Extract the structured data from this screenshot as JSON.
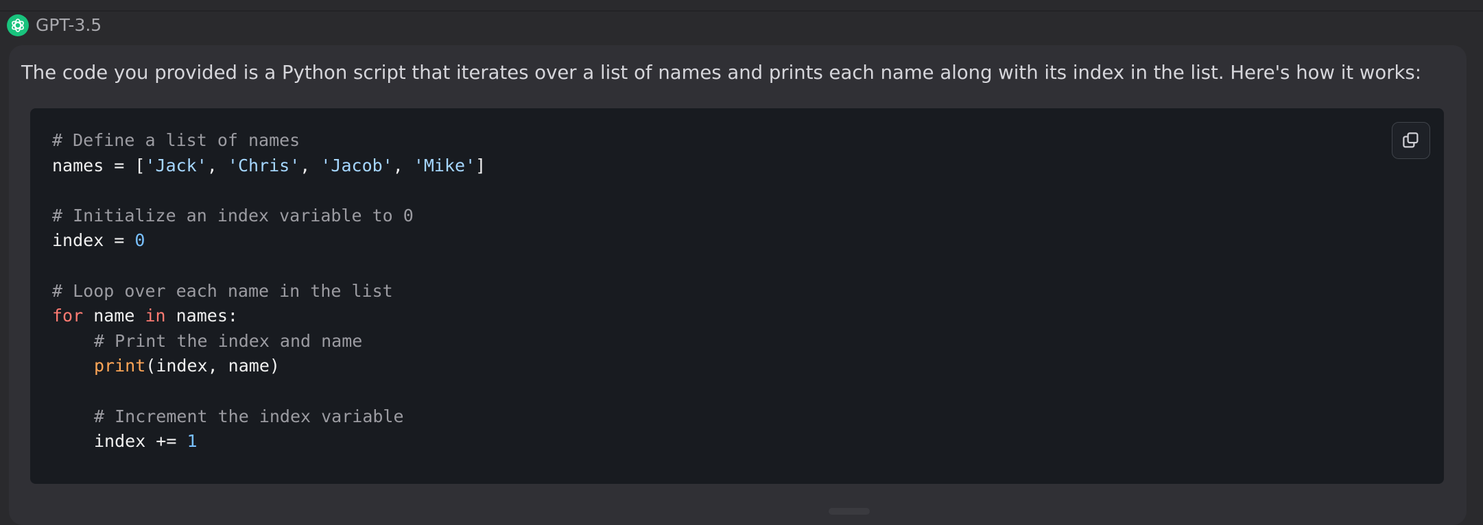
{
  "model": {
    "name": "GPT-3.5",
    "logo_icon": "openai-logo-icon",
    "logo_color": "#19c37d"
  },
  "message": {
    "intro": "The code you provided is a Python script that iterates over a list of names and prints each name along with its index in the list. Here's how it works:"
  },
  "code_block": {
    "language": "python",
    "copy_icon": "copy-icon",
    "lines": [
      {
        "indent": 0,
        "tokens": [
          {
            "t": "comment",
            "v": "# Define a list of names"
          }
        ]
      },
      {
        "indent": 0,
        "tokens": [
          {
            "t": "plain",
            "v": "names = ["
          },
          {
            "t": "string",
            "v": "'Jack'"
          },
          {
            "t": "plain",
            "v": ", "
          },
          {
            "t": "string",
            "v": "'Chris'"
          },
          {
            "t": "plain",
            "v": ", "
          },
          {
            "t": "string",
            "v": "'Jacob'"
          },
          {
            "t": "plain",
            "v": ", "
          },
          {
            "t": "string",
            "v": "'Mike'"
          },
          {
            "t": "plain",
            "v": "]"
          }
        ]
      },
      {
        "indent": 0,
        "tokens": []
      },
      {
        "indent": 0,
        "tokens": [
          {
            "t": "comment",
            "v": "# Initialize an index variable to 0"
          }
        ]
      },
      {
        "indent": 0,
        "tokens": [
          {
            "t": "plain",
            "v": "index = "
          },
          {
            "t": "number",
            "v": "0"
          }
        ]
      },
      {
        "indent": 0,
        "tokens": []
      },
      {
        "indent": 0,
        "tokens": [
          {
            "t": "comment",
            "v": "# Loop over each name in the list"
          }
        ]
      },
      {
        "indent": 0,
        "tokens": [
          {
            "t": "keyword",
            "v": "for"
          },
          {
            "t": "plain",
            "v": " name "
          },
          {
            "t": "keyword",
            "v": "in"
          },
          {
            "t": "plain",
            "v": " names:"
          }
        ]
      },
      {
        "indent": 1,
        "tokens": [
          {
            "t": "comment",
            "v": "# Print the index and name"
          }
        ]
      },
      {
        "indent": 1,
        "tokens": [
          {
            "t": "func",
            "v": "print"
          },
          {
            "t": "plain",
            "v": "(index, name)"
          }
        ]
      },
      {
        "indent": 0,
        "tokens": []
      },
      {
        "indent": 1,
        "tokens": [
          {
            "t": "comment",
            "v": "# Increment the index variable"
          }
        ]
      },
      {
        "indent": 1,
        "tokens": [
          {
            "t": "plain",
            "v": "index += "
          },
          {
            "t": "number",
            "v": "1"
          }
        ]
      }
    ]
  },
  "colors": {
    "background": "#2a2a2d",
    "card": "#303035",
    "code_bg": "#181b20",
    "comment": "#9b9ba1",
    "keyword": "#ff7b72",
    "function": "#ffa657",
    "string": "#a5d6ff",
    "number": "#79c0ff"
  }
}
